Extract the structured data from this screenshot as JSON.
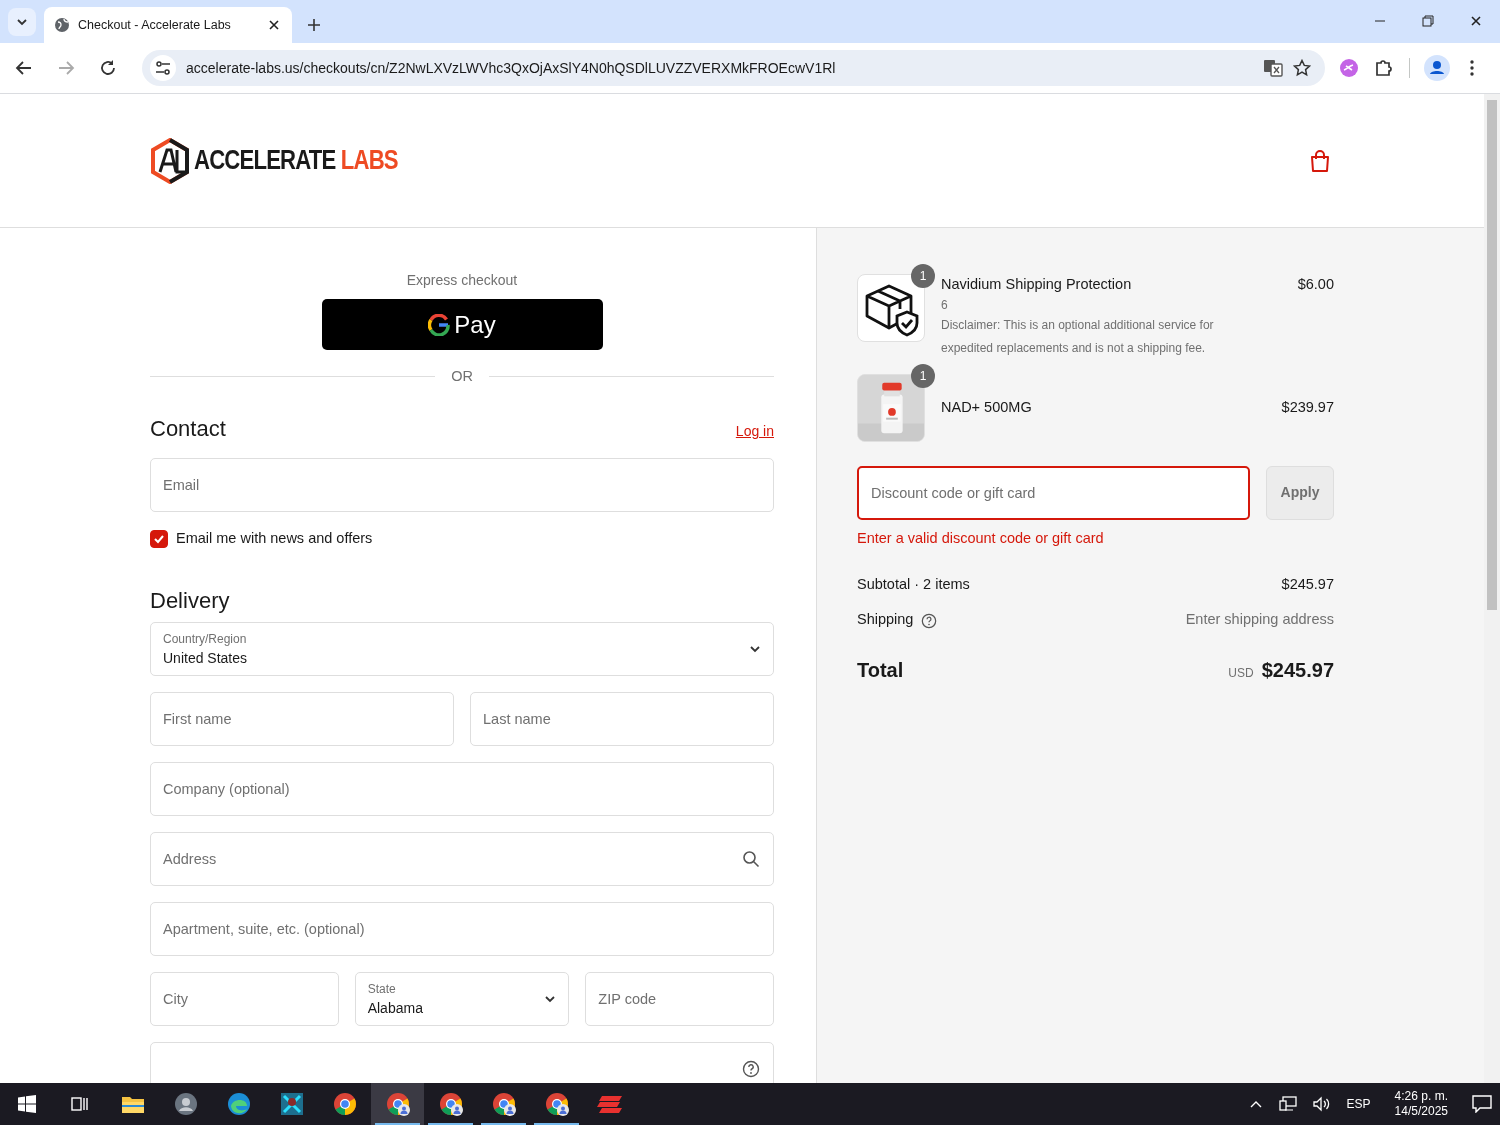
{
  "browser": {
    "tabs": [
      {
        "title": "Checkout - Accelerate Labs",
        "selected": true
      }
    ],
    "url": "accelerate-labs.us/checkouts/cn/Z2NwLXVzLWVhc3QxOjAxSlY4N0hQSDlLUVZZVERXMkFROEcwV1Rl"
  },
  "header": {
    "logo_dark": "ACCELERATE",
    "logo_accent": "LABS"
  },
  "express": {
    "label": "Express checkout",
    "gpay": "Pay",
    "divider": "OR"
  },
  "contact": {
    "heading": "Contact",
    "login": "Log in",
    "email_placeholder": "Email",
    "newsletter": {
      "label": "Email me with news and offers",
      "checked": true
    }
  },
  "delivery": {
    "heading": "Delivery",
    "rows": [
      [
        {
          "kind": "select",
          "label": "Country/Region",
          "value": "United States"
        }
      ],
      [
        {
          "kind": "text",
          "placeholder": "First name"
        },
        {
          "kind": "text",
          "placeholder": "Last name"
        }
      ],
      [
        {
          "kind": "text",
          "placeholder": "Company (optional)"
        }
      ],
      [
        {
          "kind": "search",
          "placeholder": "Address"
        }
      ],
      [
        {
          "kind": "text",
          "placeholder": "Apartment, suite, etc. (optional)"
        }
      ],
      [
        {
          "kind": "text",
          "placeholder": "City"
        },
        {
          "kind": "select",
          "label": "State",
          "value": "Alabama"
        },
        {
          "kind": "text",
          "placeholder": "ZIP code"
        }
      ],
      [
        {
          "kind": "help"
        }
      ]
    ]
  },
  "summary": {
    "items": [
      {
        "kind": "icon",
        "quantity": "1",
        "name": "Navidium Shipping Protection",
        "variant": "6",
        "note": "Disclaimer: This is an optional additional service for expedited replacements and is not a shipping fee.",
        "price": "$6.00"
      },
      {
        "kind": "picture",
        "quantity": "1",
        "name": "NAD+ 500MG",
        "price": "$239.97"
      }
    ],
    "discount": {
      "placeholder": "Discount code or gift card",
      "button": "Apply",
      "invalid": true,
      "error": "Enter a valid discount code or gift card"
    },
    "subtotal": {
      "label": "Subtotal · 2 items",
      "value": "$245.97"
    },
    "shipping": {
      "label": "Shipping",
      "value": "Enter shipping address"
    },
    "total": {
      "label": "Total",
      "currency": "USD",
      "value": "$245.97"
    }
  },
  "taskbar": {
    "apps": [
      {
        "kind": "taskview",
        "running": false,
        "active": false
      },
      {
        "kind": "folder",
        "running": false,
        "active": false
      },
      {
        "kind": "avatar",
        "running": false,
        "active": false
      },
      {
        "kind": "edge",
        "running": false,
        "active": false
      },
      {
        "kind": "game",
        "running": false,
        "active": false
      },
      {
        "kind": "chrome",
        "running": false,
        "active": false
      },
      {
        "kind": "chrome-profile",
        "running": true,
        "active": true
      },
      {
        "kind": "chrome-profile",
        "running": true,
        "active": false
      },
      {
        "kind": "chrome-profile",
        "running": true,
        "active": false
      },
      {
        "kind": "chrome-profile",
        "running": true,
        "active": false
      },
      {
        "kind": "express",
        "running": false,
        "active": false
      }
    ],
    "language": "ESP",
    "time": "4:26 p. m.",
    "date": "14/5/2025"
  }
}
